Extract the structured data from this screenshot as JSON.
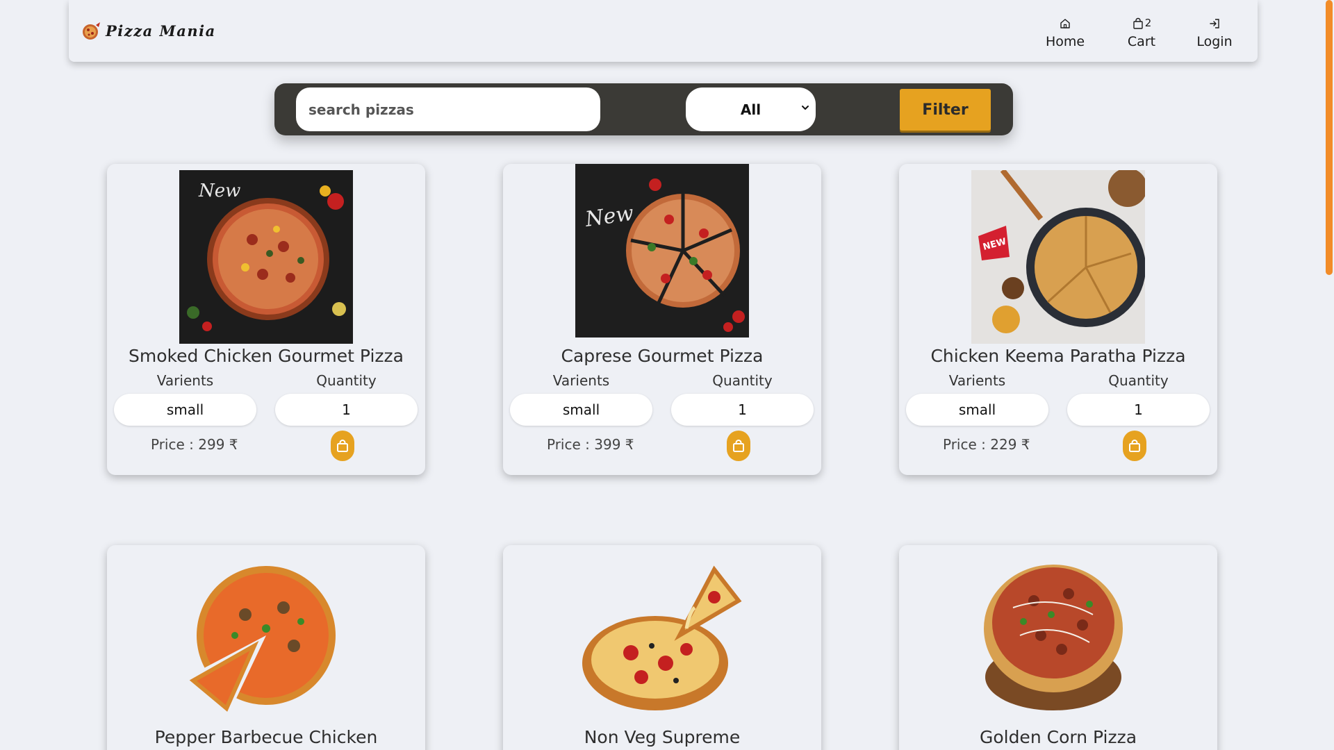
{
  "brand": {
    "name": "Pizza Mania",
    "logo_icon": "pizza-logo-icon"
  },
  "nav": {
    "home_label": "Home",
    "cart_label": "Cart",
    "cart_count": "2",
    "login_label": "Login"
  },
  "filter": {
    "search_placeholder": "search pizzas",
    "search_value": "",
    "category_selected": "All",
    "button_label": "Filter"
  },
  "colors": {
    "accent": "#e6a220",
    "filter_bar": "#3b3a36",
    "background": "#eef0f5",
    "scrollbar": "#f28c28"
  },
  "pizzas": [
    {
      "name": "Smoked Chicken Gourmet Pizza",
      "variants_label": "Varients",
      "quantity_label": "Quantity",
      "variant": "small",
      "quantity": "1",
      "price": "Price : 299 ₹"
    },
    {
      "name": "Caprese Gourmet Pizza",
      "variants_label": "Varients",
      "quantity_label": "Quantity",
      "variant": "small",
      "quantity": "1",
      "price": "Price : 399 ₹"
    },
    {
      "name": "Chicken Keema Paratha Pizza",
      "variants_label": "Varients",
      "quantity_label": "Quantity",
      "variant": "small",
      "quantity": "1",
      "price": "Price : 229 ₹"
    },
    {
      "name": "Pepper Barbecue Chicken"
    },
    {
      "name": "Non Veg Supreme"
    },
    {
      "name": "Golden Corn Pizza"
    }
  ]
}
